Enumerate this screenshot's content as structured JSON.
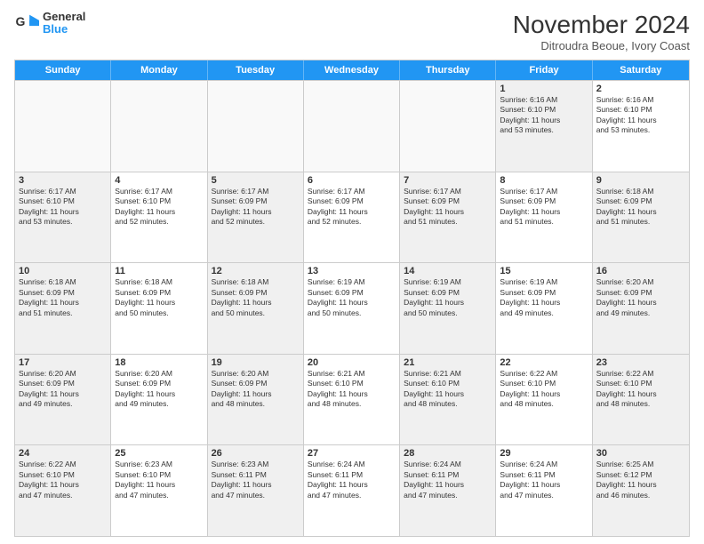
{
  "logo": {
    "line1": "General",
    "line2": "Blue"
  },
  "title": "November 2024",
  "subtitle": "Ditroudra Beoue, Ivory Coast",
  "days_of_week": [
    "Sunday",
    "Monday",
    "Tuesday",
    "Wednesday",
    "Thursday",
    "Friday",
    "Saturday"
  ],
  "weeks": [
    [
      {
        "day": "",
        "empty": true
      },
      {
        "day": "",
        "empty": true
      },
      {
        "day": "",
        "empty": true
      },
      {
        "day": "",
        "empty": true
      },
      {
        "day": "",
        "empty": true
      },
      {
        "day": "1",
        "info": "Sunrise: 6:16 AM\nSunset: 6:10 PM\nDaylight: 11 hours\nand 53 minutes.",
        "shaded": true
      },
      {
        "day": "2",
        "info": "Sunrise: 6:16 AM\nSunset: 6:10 PM\nDaylight: 11 hours\nand 53 minutes.",
        "shaded": false
      }
    ],
    [
      {
        "day": "3",
        "info": "Sunrise: 6:17 AM\nSunset: 6:10 PM\nDaylight: 11 hours\nand 53 minutes.",
        "shaded": true
      },
      {
        "day": "4",
        "info": "Sunrise: 6:17 AM\nSunset: 6:10 PM\nDaylight: 11 hours\nand 52 minutes.",
        "shaded": false
      },
      {
        "day": "5",
        "info": "Sunrise: 6:17 AM\nSunset: 6:09 PM\nDaylight: 11 hours\nand 52 minutes.",
        "shaded": true
      },
      {
        "day": "6",
        "info": "Sunrise: 6:17 AM\nSunset: 6:09 PM\nDaylight: 11 hours\nand 52 minutes.",
        "shaded": false
      },
      {
        "day": "7",
        "info": "Sunrise: 6:17 AM\nSunset: 6:09 PM\nDaylight: 11 hours\nand 51 minutes.",
        "shaded": true
      },
      {
        "day": "8",
        "info": "Sunrise: 6:17 AM\nSunset: 6:09 PM\nDaylight: 11 hours\nand 51 minutes.",
        "shaded": false
      },
      {
        "day": "9",
        "info": "Sunrise: 6:18 AM\nSunset: 6:09 PM\nDaylight: 11 hours\nand 51 minutes.",
        "shaded": true
      }
    ],
    [
      {
        "day": "10",
        "info": "Sunrise: 6:18 AM\nSunset: 6:09 PM\nDaylight: 11 hours\nand 51 minutes.",
        "shaded": true
      },
      {
        "day": "11",
        "info": "Sunrise: 6:18 AM\nSunset: 6:09 PM\nDaylight: 11 hours\nand 50 minutes.",
        "shaded": false
      },
      {
        "day": "12",
        "info": "Sunrise: 6:18 AM\nSunset: 6:09 PM\nDaylight: 11 hours\nand 50 minutes.",
        "shaded": true
      },
      {
        "day": "13",
        "info": "Sunrise: 6:19 AM\nSunset: 6:09 PM\nDaylight: 11 hours\nand 50 minutes.",
        "shaded": false
      },
      {
        "day": "14",
        "info": "Sunrise: 6:19 AM\nSunset: 6:09 PM\nDaylight: 11 hours\nand 50 minutes.",
        "shaded": true
      },
      {
        "day": "15",
        "info": "Sunrise: 6:19 AM\nSunset: 6:09 PM\nDaylight: 11 hours\nand 49 minutes.",
        "shaded": false
      },
      {
        "day": "16",
        "info": "Sunrise: 6:20 AM\nSunset: 6:09 PM\nDaylight: 11 hours\nand 49 minutes.",
        "shaded": true
      }
    ],
    [
      {
        "day": "17",
        "info": "Sunrise: 6:20 AM\nSunset: 6:09 PM\nDaylight: 11 hours\nand 49 minutes.",
        "shaded": true
      },
      {
        "day": "18",
        "info": "Sunrise: 6:20 AM\nSunset: 6:09 PM\nDaylight: 11 hours\nand 49 minutes.",
        "shaded": false
      },
      {
        "day": "19",
        "info": "Sunrise: 6:20 AM\nSunset: 6:09 PM\nDaylight: 11 hours\nand 48 minutes.",
        "shaded": true
      },
      {
        "day": "20",
        "info": "Sunrise: 6:21 AM\nSunset: 6:10 PM\nDaylight: 11 hours\nand 48 minutes.",
        "shaded": false
      },
      {
        "day": "21",
        "info": "Sunrise: 6:21 AM\nSunset: 6:10 PM\nDaylight: 11 hours\nand 48 minutes.",
        "shaded": true
      },
      {
        "day": "22",
        "info": "Sunrise: 6:22 AM\nSunset: 6:10 PM\nDaylight: 11 hours\nand 48 minutes.",
        "shaded": false
      },
      {
        "day": "23",
        "info": "Sunrise: 6:22 AM\nSunset: 6:10 PM\nDaylight: 11 hours\nand 48 minutes.",
        "shaded": true
      }
    ],
    [
      {
        "day": "24",
        "info": "Sunrise: 6:22 AM\nSunset: 6:10 PM\nDaylight: 11 hours\nand 47 minutes.",
        "shaded": true
      },
      {
        "day": "25",
        "info": "Sunrise: 6:23 AM\nSunset: 6:10 PM\nDaylight: 11 hours\nand 47 minutes.",
        "shaded": false
      },
      {
        "day": "26",
        "info": "Sunrise: 6:23 AM\nSunset: 6:11 PM\nDaylight: 11 hours\nand 47 minutes.",
        "shaded": true
      },
      {
        "day": "27",
        "info": "Sunrise: 6:24 AM\nSunset: 6:11 PM\nDaylight: 11 hours\nand 47 minutes.",
        "shaded": false
      },
      {
        "day": "28",
        "info": "Sunrise: 6:24 AM\nSunset: 6:11 PM\nDaylight: 11 hours\nand 47 minutes.",
        "shaded": true
      },
      {
        "day": "29",
        "info": "Sunrise: 6:24 AM\nSunset: 6:11 PM\nDaylight: 11 hours\nand 47 minutes.",
        "shaded": false
      },
      {
        "day": "30",
        "info": "Sunrise: 6:25 AM\nSunset: 6:12 PM\nDaylight: 11 hours\nand 46 minutes.",
        "shaded": true
      }
    ]
  ]
}
